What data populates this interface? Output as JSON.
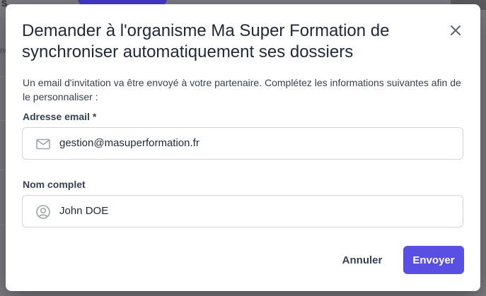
{
  "background": {
    "left_fragment_top": "S",
    "left_fragment_mid": "ne"
  },
  "modal": {
    "title": "Demander à l'organisme Ma Super Formation de synchroniser automatiquement ses dossiers",
    "intro": "Un email d'invitation va être envoyé à votre partenaire. Complétez les informations suivantes afin de le personnaliser :",
    "email": {
      "label": "Adresse email *",
      "value": "gestion@masuperformation.fr",
      "icon": "mail-icon"
    },
    "name": {
      "label": "Nom complet",
      "value": "John DOE",
      "icon": "user-circle-icon"
    },
    "cancel_label": "Annuler",
    "send_label": "Envoyer",
    "close_icon": "close-icon"
  },
  "colors": {
    "accent": "#5a4fe3",
    "overlay": "#7b7b80"
  }
}
